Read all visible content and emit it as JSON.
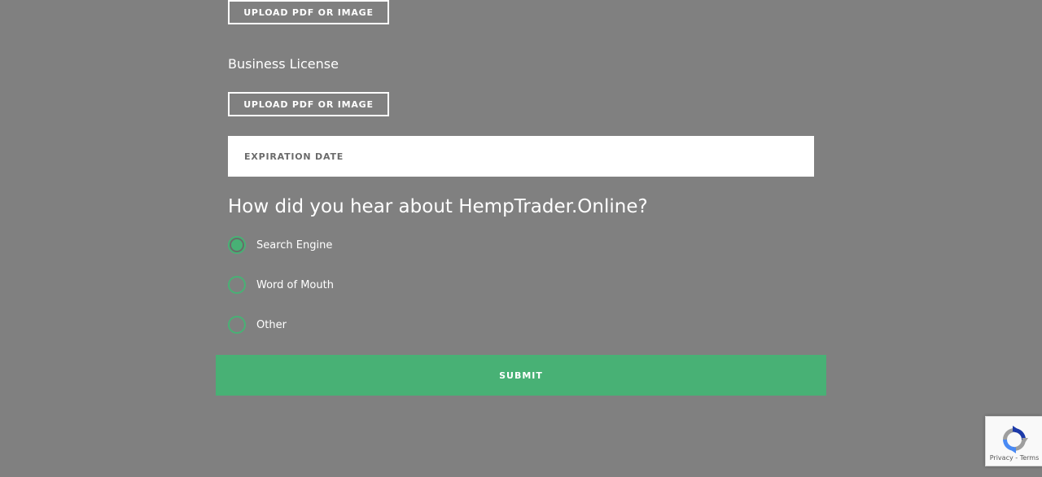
{
  "uploads": {
    "first_label": "UPLOAD PDF OR IMAGE",
    "business_license_label": "Business License",
    "second_label": "UPLOAD PDF OR IMAGE"
  },
  "expiration": {
    "placeholder": "EXPIRATION DATE",
    "value": ""
  },
  "survey": {
    "question": "How did you hear about HempTrader.Online?",
    "options": [
      {
        "label": "Search Engine",
        "checked": true
      },
      {
        "label": "Word of Mouth",
        "checked": false
      },
      {
        "label": "Other",
        "checked": false
      }
    ]
  },
  "form": {
    "submit_label": "SUBMIT"
  },
  "recaptcha": {
    "privacy_label": "Privacy",
    "separator": " - ",
    "terms_label": "Terms",
    "icon": "recaptcha-logo-icon"
  },
  "colors": {
    "accent": "#48b175",
    "background": "#808080"
  }
}
